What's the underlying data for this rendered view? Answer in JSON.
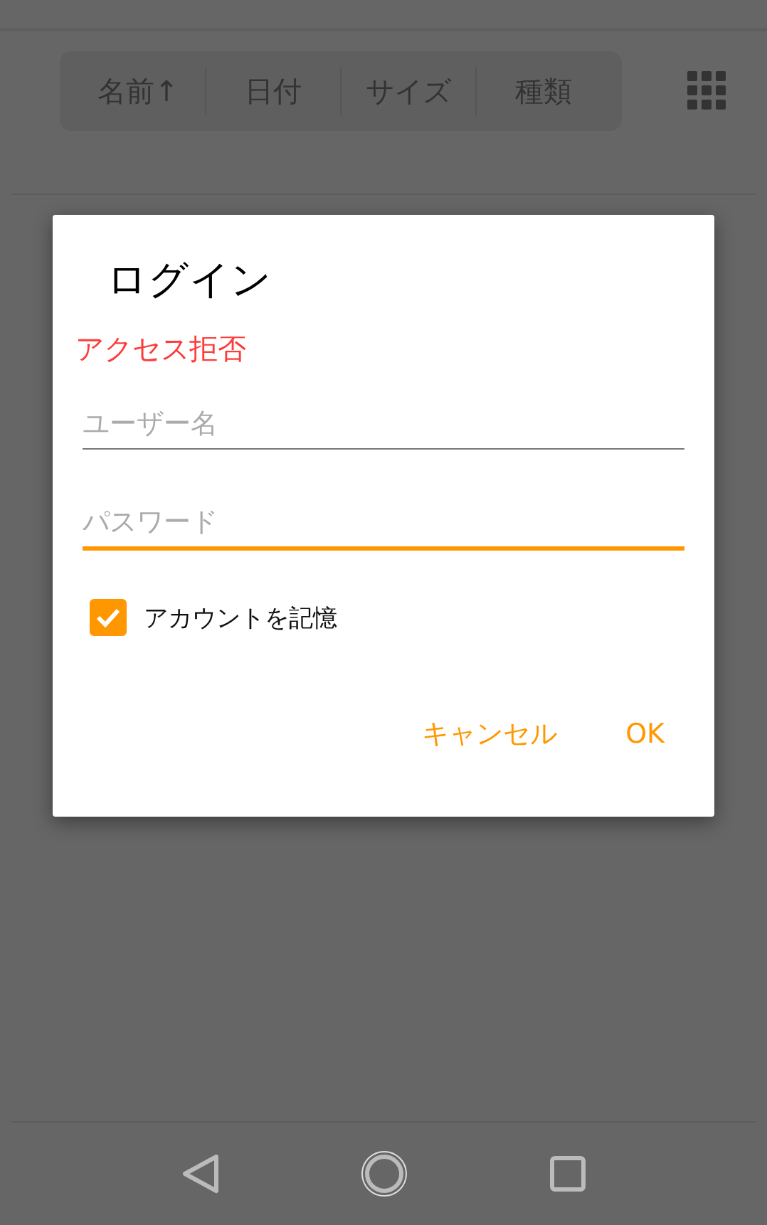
{
  "sort_bar": {
    "items": [
      {
        "label": "名前↑"
      },
      {
        "label": "日付"
      },
      {
        "label": "サイズ"
      },
      {
        "label": "種類"
      }
    ]
  },
  "dialog": {
    "title": "ログイン",
    "error": "アクセス拒否",
    "fields": [
      {
        "placeholder": "ユーザー名",
        "focused": false
      },
      {
        "placeholder": "パスワード",
        "focused": true
      }
    ],
    "remember": {
      "label": "アカウントを記憶",
      "checked": true
    },
    "buttons": [
      "キャンセル",
      "OK"
    ]
  }
}
